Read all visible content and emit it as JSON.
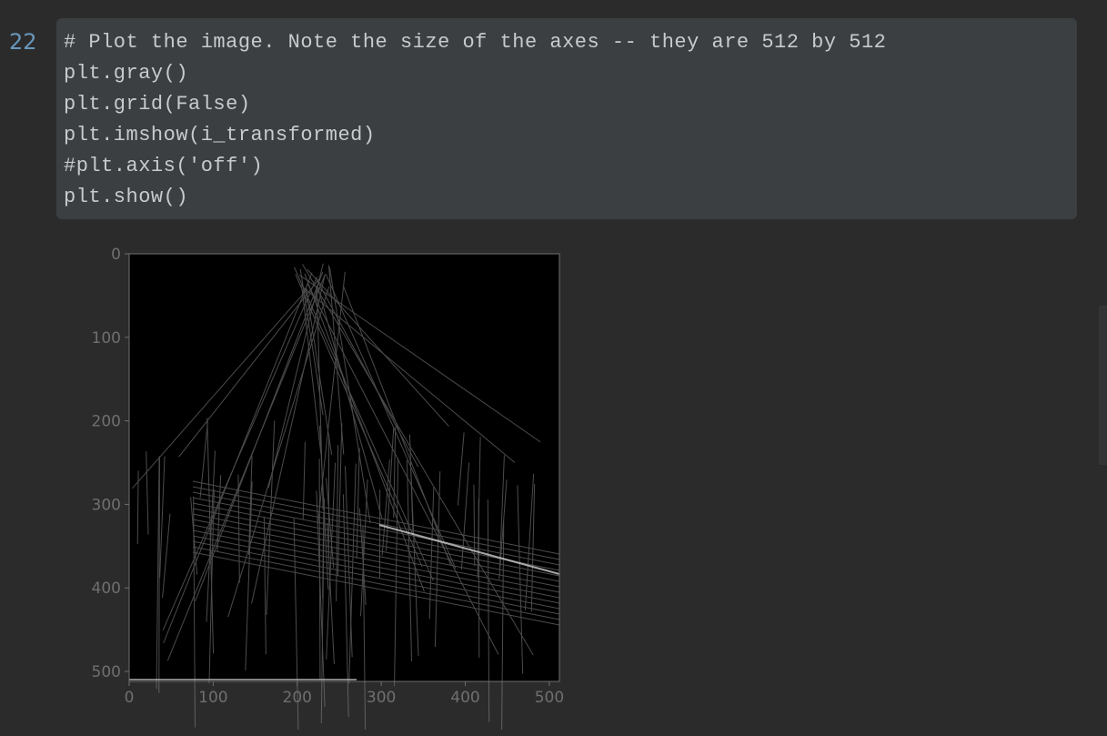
{
  "cell": {
    "prompt_number": "22",
    "code_lines": [
      "# Plot the image. Note the size of the axes -- they are 512 by 512",
      "plt.gray()",
      "plt.grid(False)",
      "plt.imshow(i_transformed)",
      "#plt.axis('off')",
      "plt.show()"
    ]
  },
  "colors": {
    "background": "#2b2b2b",
    "code_background": "#3b3f42",
    "code_text": "#c8cbce",
    "prompt": "#6897bb",
    "axis": "#6f6f6f",
    "image_background": "#000000"
  },
  "chart_data": {
    "type": "image",
    "colormap": "gray",
    "grid": false,
    "xlim": [
      0,
      512
    ],
    "ylim": [
      512,
      0
    ],
    "x_ticks": [
      "0",
      "100",
      "200",
      "300",
      "400",
      "500"
    ],
    "y_ticks": [
      "0",
      "100",
      "200",
      "300",
      "400",
      "500"
    ],
    "x_tick_values": [
      0,
      100,
      200,
      300,
      400,
      500
    ],
    "y_tick_values": [
      0,
      100,
      200,
      300,
      400,
      500
    ]
  }
}
